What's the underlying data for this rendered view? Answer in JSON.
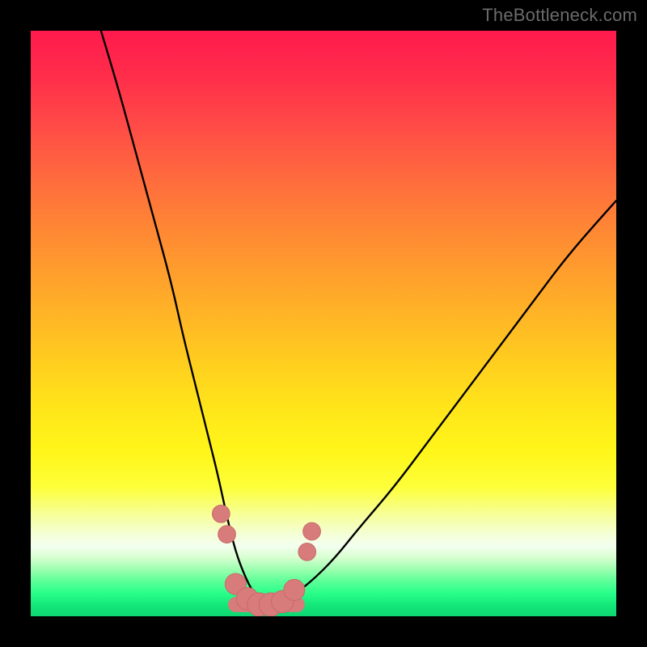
{
  "watermark": "TheBottleneck.com",
  "colors": {
    "frame": "#000000",
    "curve": "#000000",
    "marker_fill": "#d87b7b",
    "marker_stroke": "#c96a6a"
  },
  "chart_data": {
    "type": "line",
    "title": "",
    "xlabel": "",
    "ylabel": "",
    "xlim": [
      0,
      100
    ],
    "ylim": [
      0,
      100
    ],
    "grid": false,
    "legend": false,
    "series": [
      {
        "name": "bottleneck-curve",
        "x": [
          12,
          15,
          18,
          21,
          24,
          26,
          28,
          30,
          32,
          33.5,
          35,
          36.5,
          38,
          40,
          42,
          44,
          48,
          52,
          56,
          62,
          68,
          74,
          80,
          86,
          92,
          100
        ],
        "y": [
          100,
          90,
          79,
          68,
          57,
          48,
          40,
          32,
          24,
          17,
          11,
          7,
          4,
          2,
          2,
          3,
          6,
          10,
          15,
          22,
          30,
          38,
          46,
          54,
          62,
          71
        ]
      }
    ],
    "markers": [
      {
        "x": 32.5,
        "y": 17.5,
        "r": 1.5
      },
      {
        "x": 33.5,
        "y": 14.0,
        "r": 1.5
      },
      {
        "x": 35.0,
        "y": 5.5,
        "r": 1.8
      },
      {
        "x": 37.0,
        "y": 3.0,
        "r": 1.9
      },
      {
        "x": 39.0,
        "y": 2.0,
        "r": 2.0
      },
      {
        "x": 41.0,
        "y": 2.0,
        "r": 2.0
      },
      {
        "x": 43.0,
        "y": 2.5,
        "r": 1.9
      },
      {
        "x": 45.0,
        "y": 4.5,
        "r": 1.8
      },
      {
        "x": 47.2,
        "y": 11.0,
        "r": 1.5
      },
      {
        "x": 48.0,
        "y": 14.5,
        "r": 1.5
      }
    ],
    "bottom_band": {
      "x_start": 35.0,
      "x_end": 45.5,
      "y": 2.0,
      "thickness": 2.6
    }
  }
}
